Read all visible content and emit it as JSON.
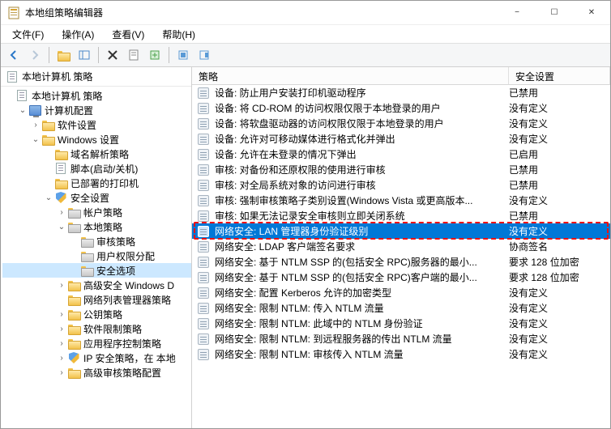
{
  "window": {
    "title": "本地组策略编辑器"
  },
  "menubar": {
    "file": "文件(F)",
    "action": "操作(A)",
    "view": "查看(V)",
    "help": "帮助(H)"
  },
  "left": {
    "header": "本地计算机 策略",
    "tree": [
      {
        "id": "root",
        "label": "本地计算机 策略",
        "indent": 0,
        "icon": "doc",
        "twisty": ""
      },
      {
        "id": "comp-config",
        "label": "计算机配置",
        "indent": 1,
        "icon": "pc",
        "twisty": "open"
      },
      {
        "id": "soft-settings",
        "label": "软件设置",
        "indent": 2,
        "icon": "folder",
        "twisty": "closed"
      },
      {
        "id": "win-settings",
        "label": "Windows 设置",
        "indent": 2,
        "icon": "folder",
        "twisty": "open"
      },
      {
        "id": "name-res",
        "label": "域名解析策略",
        "indent": 3,
        "icon": "folder",
        "twisty": ""
      },
      {
        "id": "scripts",
        "label": "脚本(启动/关机)",
        "indent": 3,
        "icon": "doc",
        "twisty": ""
      },
      {
        "id": "printers",
        "label": "已部署的打印机",
        "indent": 3,
        "icon": "folder",
        "twisty": ""
      },
      {
        "id": "sec-settings",
        "label": "安全设置",
        "indent": 3,
        "icon": "shield",
        "twisty": "open"
      },
      {
        "id": "acct-policy",
        "label": "帐户策略",
        "indent": 4,
        "icon": "folder-gear",
        "twisty": "closed"
      },
      {
        "id": "local-policy",
        "label": "本地策略",
        "indent": 4,
        "icon": "folder-gear",
        "twisty": "open"
      },
      {
        "id": "audit-policy",
        "label": "审核策略",
        "indent": 5,
        "icon": "folder-gear",
        "twisty": ""
      },
      {
        "id": "user-rights",
        "label": "用户权限分配",
        "indent": 5,
        "icon": "folder-gear",
        "twisty": ""
      },
      {
        "id": "sec-options",
        "label": "安全选项",
        "indent": 5,
        "icon": "folder-gear",
        "twisty": "",
        "selected": true
      },
      {
        "id": "fw-adv",
        "label": "高级安全 Windows D",
        "indent": 4,
        "icon": "folder",
        "twisty": "closed"
      },
      {
        "id": "nlm",
        "label": "网络列表管理器策略",
        "indent": 4,
        "icon": "folder",
        "twisty": ""
      },
      {
        "id": "pk-policy",
        "label": "公钥策略",
        "indent": 4,
        "icon": "folder",
        "twisty": "closed"
      },
      {
        "id": "sw-restrict",
        "label": "软件限制策略",
        "indent": 4,
        "icon": "folder",
        "twisty": "closed"
      },
      {
        "id": "app-control",
        "label": "应用程序控制策略",
        "indent": 4,
        "icon": "folder",
        "twisty": "closed"
      },
      {
        "id": "ipsec",
        "label": "IP 安全策略，在 本地",
        "indent": 4,
        "icon": "shield",
        "twisty": "closed"
      },
      {
        "id": "adv-audit",
        "label": "高级审核策略配置",
        "indent": 4,
        "icon": "folder",
        "twisty": "closed"
      }
    ]
  },
  "right": {
    "headers": {
      "c1": "策略",
      "c2": "安全设置"
    },
    "rows": [
      {
        "label": "设备: 防止用户安装打印机驱动程序",
        "value": "已禁用"
      },
      {
        "label": "设备: 将 CD-ROM 的访问权限仅限于本地登录的用户",
        "value": "没有定义"
      },
      {
        "label": "设备: 将软盘驱动器的访问权限仅限于本地登录的用户",
        "value": "没有定义"
      },
      {
        "label": "设备: 允许对可移动媒体进行格式化并弹出",
        "value": "没有定义"
      },
      {
        "label": "设备: 允许在未登录的情况下弹出",
        "value": "已启用"
      },
      {
        "label": "审核: 对备份和还原权限的使用进行审核",
        "value": "已禁用"
      },
      {
        "label": "审核: 对全局系统对象的访问进行审核",
        "value": "已禁用"
      },
      {
        "label": "审核: 强制审核策略子类别设置(Windows Vista 或更高版本...",
        "value": "没有定义"
      },
      {
        "label": "审核: 如果无法记录安全审核则立即关闭系统",
        "value": "已禁用"
      },
      {
        "label": "网络安全: LAN 管理器身份验证级别",
        "value": "没有定义",
        "selected": true,
        "highlight": true
      },
      {
        "label": "网络安全: LDAP 客户端签名要求",
        "value": "协商签名"
      },
      {
        "label": "网络安全: 基于 NTLM SSP 的(包括安全 RPC)服务器的最小...",
        "value": "要求 128 位加密"
      },
      {
        "label": "网络安全: 基于 NTLM SSP 的(包括安全 RPC)客户端的最小...",
        "value": "要求 128 位加密"
      },
      {
        "label": "网络安全: 配置 Kerberos 允许的加密类型",
        "value": "没有定义"
      },
      {
        "label": "网络安全: 限制 NTLM: 传入 NTLM 流量",
        "value": "没有定义"
      },
      {
        "label": "网络安全: 限制 NTLM: 此域中的 NTLM 身份验证",
        "value": "没有定义"
      },
      {
        "label": "网络安全: 限制 NTLM: 到远程服务器的传出 NTLM 流量",
        "value": "没有定义"
      },
      {
        "label": "网络安全: 限制 NTLM: 审核传入 NTLM 流量",
        "value": "没有定义"
      }
    ]
  }
}
